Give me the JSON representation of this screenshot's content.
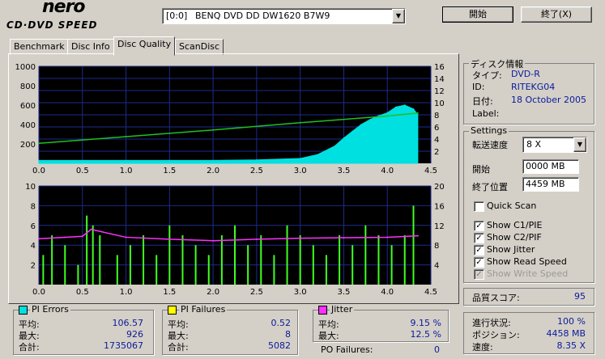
{
  "app": {
    "logo_top": "nero",
    "logo_bottom": "CD·DVD SPEED"
  },
  "drive": {
    "id": "[0:0]",
    "name": "BENQ DVD DD DW1620 B7W9"
  },
  "buttons": {
    "start": "開始",
    "exit": "終了(X)"
  },
  "tabs": [
    {
      "label": "Benchmark"
    },
    {
      "label": "Disc Info"
    },
    {
      "label": "Disc Quality"
    },
    {
      "label": "ScanDisc"
    }
  ],
  "disc_info": {
    "title": "ディスク情報",
    "type_label": "タイプ:",
    "type_value": "DVD-R",
    "id_label": "ID:",
    "id_value": "RITEKG04",
    "date_label": "日付:",
    "date_value": "18 October 2005",
    "label_label": "Label:",
    "label_value": ""
  },
  "settings": {
    "title": "Settings",
    "speed_label": "転送速度",
    "speed_value": "8 X",
    "start_label": "開始",
    "start_value": "0000 MB",
    "end_label": "終了位置",
    "end_value": "4459 MB",
    "quick_scan": "Quick Scan",
    "show_c1": "Show C1/PIE",
    "show_c2": "Show C2/PIF",
    "show_jitter": "Show Jitter",
    "show_read": "Show Read Speed",
    "show_write": "Show Write Speed"
  },
  "quality": {
    "label": "品質スコア:",
    "value": "95"
  },
  "progress": {
    "status_label": "進行状況:",
    "status_value": "100 %",
    "position_label": "ポジション:",
    "position_value": "4458 MB",
    "speed_label": "速度:",
    "speed_value": "8.35 X"
  },
  "pi_errors": {
    "title": "PI Errors",
    "avg_label": "平均:",
    "avg": "106.57",
    "max_label": "最大:",
    "max": "926",
    "total_label": "合計:",
    "total": "1735067"
  },
  "pi_failures": {
    "title": "PI Failures",
    "avg_label": "平均:",
    "avg": "0.52",
    "max_label": "最大:",
    "max": "8",
    "total_label": "合計:",
    "total": "5082"
  },
  "jitter": {
    "title": "Jitter",
    "avg_label": "平均:",
    "avg": "9.15 %",
    "max_label": "最大:",
    "max": "12.5 %"
  },
  "po_failures": {
    "label": "PO Failures:",
    "value": "0"
  },
  "colors": {
    "plot_bg": "#000000",
    "grid": "#1e2a8c",
    "pie": "#00e0e0",
    "pif": "#40ff20",
    "jitter": "#ff30ff",
    "read": "#20c020",
    "accent_text": "#0a1a9a"
  },
  "chart_data": [
    {
      "type": "area",
      "x_ticks": [
        "0.0",
        "0.5",
        "1.0",
        "1.5",
        "2.0",
        "2.5",
        "3.0",
        "3.5",
        "4.0",
        "4.5"
      ],
      "y_ticks": [
        "200",
        "400",
        "600",
        "800",
        "1000"
      ],
      "y2_ticks": [
        "2",
        "4",
        "6",
        "8",
        "10",
        "12",
        "14",
        "16"
      ],
      "xlim": [
        0,
        4.5
      ],
      "ylim": [
        0,
        1000
      ],
      "y2lim": [
        0,
        16
      ],
      "series": [
        {
          "name": "PI Errors",
          "color": "#00e0e0",
          "x": [
            0.0,
            0.5,
            1.0,
            1.5,
            2.0,
            2.5,
            3.0,
            3.2,
            3.4,
            3.5,
            3.6,
            3.7,
            3.8,
            3.9,
            4.0,
            4.1,
            4.2,
            4.3,
            4.35
          ],
          "y": [
            30,
            30,
            30,
            30,
            30,
            35,
            50,
            90,
            180,
            260,
            330,
            400,
            450,
            490,
            520,
            580,
            600,
            560,
            500
          ]
        },
        {
          "name": "Read Speed",
          "axis": "y2",
          "color": "#20c020",
          "x": [
            0.0,
            1.0,
            2.0,
            3.0,
            4.0,
            4.35
          ],
          "y": [
            3.3,
            4.4,
            5.5,
            6.7,
            7.8,
            8.3
          ]
        }
      ],
      "grid": true
    },
    {
      "type": "bar",
      "x_ticks": [
        "0.0",
        "0.5",
        "1.0",
        "1.5",
        "2.0",
        "2.5",
        "3.0",
        "3.5",
        "4.0",
        "4.5"
      ],
      "y_ticks": [
        "2",
        "4",
        "6",
        "8",
        "10"
      ],
      "y2_ticks": [
        "4",
        "8",
        "12",
        "16",
        "20"
      ],
      "xlim": [
        0,
        4.5
      ],
      "ylim": [
        0,
        10
      ],
      "y2lim": [
        0,
        20
      ],
      "series": [
        {
          "name": "PI Failures",
          "color": "#40ff20",
          "x": [
            0.05,
            0.15,
            0.3,
            0.45,
            0.55,
            0.62,
            0.7,
            0.9,
            1.05,
            1.2,
            1.35,
            1.5,
            1.65,
            1.8,
            1.95,
            2.1,
            2.25,
            2.4,
            2.55,
            2.7,
            2.85,
            3.0,
            3.15,
            3.3,
            3.45,
            3.6,
            3.75,
            3.9,
            4.05,
            4.2,
            4.3
          ],
          "y": [
            3,
            5,
            4,
            2,
            7,
            6,
            5,
            3,
            4,
            5,
            3,
            6,
            5,
            4,
            3,
            5,
            6,
            4,
            5,
            3,
            6,
            5,
            4,
            3,
            5,
            4,
            6,
            5,
            4,
            5,
            8
          ]
        },
        {
          "name": "Jitter",
          "axis": "y2",
          "color": "#ff30ff",
          "x": [
            0.0,
            0.3,
            0.5,
            0.6,
            1.0,
            1.5,
            2.0,
            2.5,
            3.0,
            3.5,
            4.0,
            4.35
          ],
          "y": [
            9.3,
            9.6,
            9.8,
            11.2,
            9.6,
            9.2,
            8.9,
            9.2,
            9.4,
            9.5,
            9.6,
            9.9
          ]
        }
      ],
      "grid": true
    }
  ]
}
